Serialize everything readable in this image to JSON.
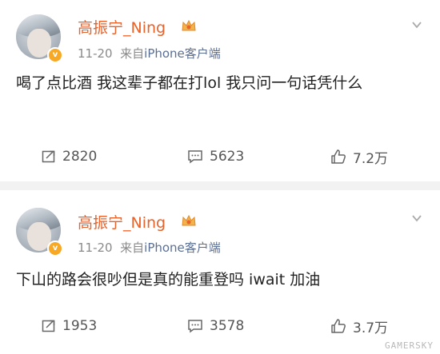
{
  "posts": [
    {
      "username": "高振宁_Ning",
      "date": "11-20",
      "source_prefix": "来自",
      "source": "iPhone客户端",
      "content": "喝了点比酒 我这辈子都在打lol 我只问一句话凭什么",
      "reposts": "2820",
      "comments": "5623",
      "likes": "7.2万"
    },
    {
      "username": "高振宁_Ning",
      "date": "11-20",
      "source_prefix": "来自",
      "source": "iPhone客户端",
      "content": "下山的路会很吵但是真的能重登吗 iwait 加油",
      "reposts": "1953",
      "comments": "3578",
      "likes": "3.7万"
    }
  ],
  "icons": {
    "verified": "verified-badge-icon",
    "crown": "crown-icon",
    "menu": "chevron-down-icon",
    "repost": "repost-icon",
    "comment": "comment-icon",
    "like": "thumbs-up-icon"
  },
  "colors": {
    "username": "#e8622a",
    "source": "#5b6f95",
    "verified": "#f7a825"
  },
  "watermark": "GAMERSKY"
}
